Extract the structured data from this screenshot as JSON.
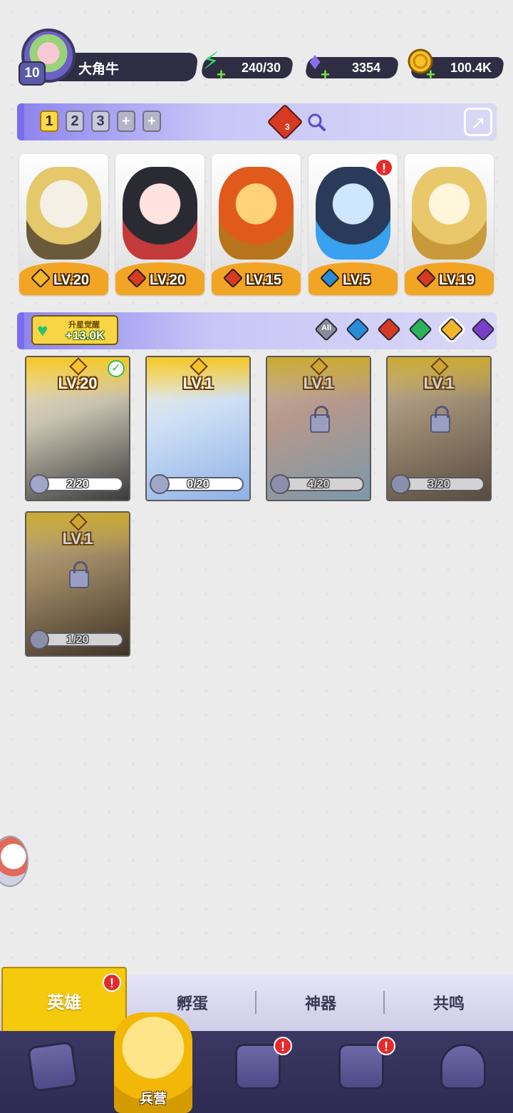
{
  "player": {
    "level": "10",
    "name": "大角牛"
  },
  "resources": {
    "energy": {
      "icon": "lightning-icon",
      "value": "240/30"
    },
    "gems": {
      "icon": "diamond-icon",
      "value": "3354"
    },
    "gold": {
      "icon": "coin-icon",
      "value": "100.4K"
    }
  },
  "team_tabs": [
    "1",
    "2",
    "3",
    "+",
    "+"
  ],
  "team_power_count": "3",
  "heroes": [
    {
      "level": "LV.20",
      "element": "light"
    },
    {
      "level": "LV.20",
      "element": "fire"
    },
    {
      "level": "LV.15",
      "element": "fire"
    },
    {
      "level": "LV.5",
      "element": "water",
      "alert": "!"
    },
    {
      "level": "LV.19",
      "element": "fire"
    }
  ],
  "awaken": {
    "label": "升星觉醒",
    "amount": "+13.0K"
  },
  "filters": {
    "all_label": "All",
    "selected": "light"
  },
  "cards": [
    {
      "level": "LV.20",
      "progress": "2/20",
      "progress_value": 0.1,
      "locked": false,
      "checked": true
    },
    {
      "level": "LV.1",
      "progress": "0/20",
      "progress_value": 0.0,
      "locked": false,
      "checked": false
    },
    {
      "level": "LV.1",
      "progress": "4/20",
      "progress_value": 0.2,
      "locked": true,
      "checked": false
    },
    {
      "level": "LV.1",
      "progress": "3/20",
      "progress_value": 0.15,
      "locked": true,
      "checked": false
    },
    {
      "level": "LV.1",
      "progress": "1/20",
      "progress_value": 0.05,
      "locked": true,
      "checked": false
    }
  ],
  "subtabs": {
    "heroes": "英雄",
    "hatch": "孵蛋",
    "artifact": "神器",
    "resonance": "共鸣",
    "alert": "!"
  },
  "bottom_nav": {
    "active_label": "兵营",
    "alert": "!"
  },
  "colors": {
    "accent": "#7a6cf0",
    "gold": "#f5c90c",
    "fire": "#d63a22",
    "water": "#2a8bd8",
    "wind": "#2bb35c",
    "light": "#f2b72a",
    "dark": "#7a3fc7"
  }
}
